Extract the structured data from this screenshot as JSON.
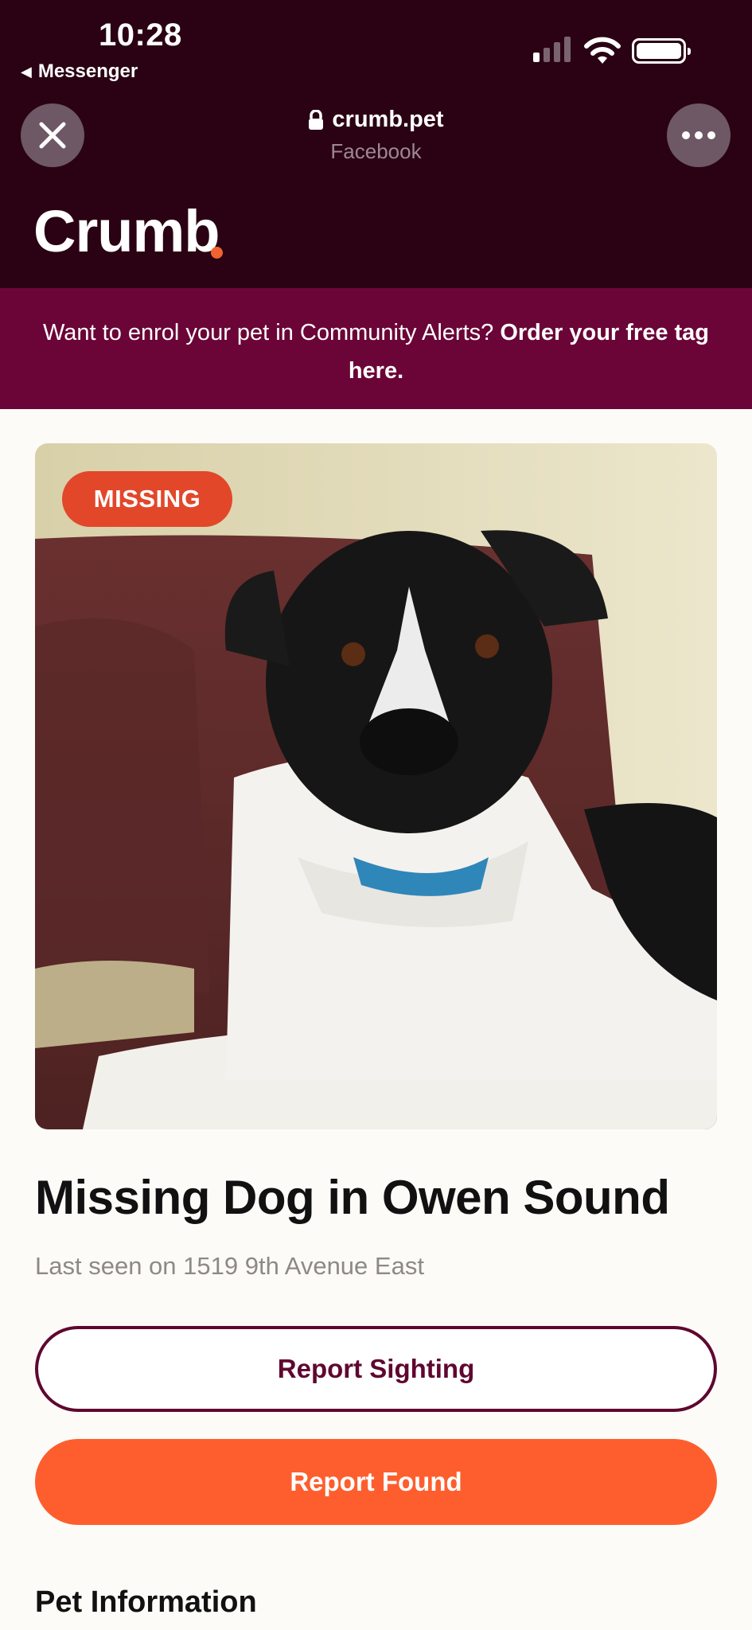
{
  "status_bar": {
    "time": "10:28",
    "back_label": "Messenger"
  },
  "browser": {
    "url": "crumb.pet",
    "subtitle": "Facebook",
    "close_icon": "close-icon",
    "more_icon": "more-icon"
  },
  "brand": {
    "name": "Crumb",
    "accent": "#f0622e"
  },
  "banner": {
    "text": "Want to enrol your pet in Community Alerts? ",
    "link_text": "Order your free tag here."
  },
  "pet": {
    "status_badge": "MISSING",
    "title": "Missing Dog in Owen Sound",
    "last_seen": "Last seen on 1519 9th Avenue East"
  },
  "actions": {
    "report_sighting": "Report Sighting",
    "report_found": "Report Found"
  },
  "section": {
    "pet_information": "Pet Information"
  },
  "colors": {
    "dark": "#2a0213",
    "banner": "#6b0537",
    "accent": "#fe5e2e",
    "badge": "#e2472a",
    "outline": "#5f0730"
  }
}
